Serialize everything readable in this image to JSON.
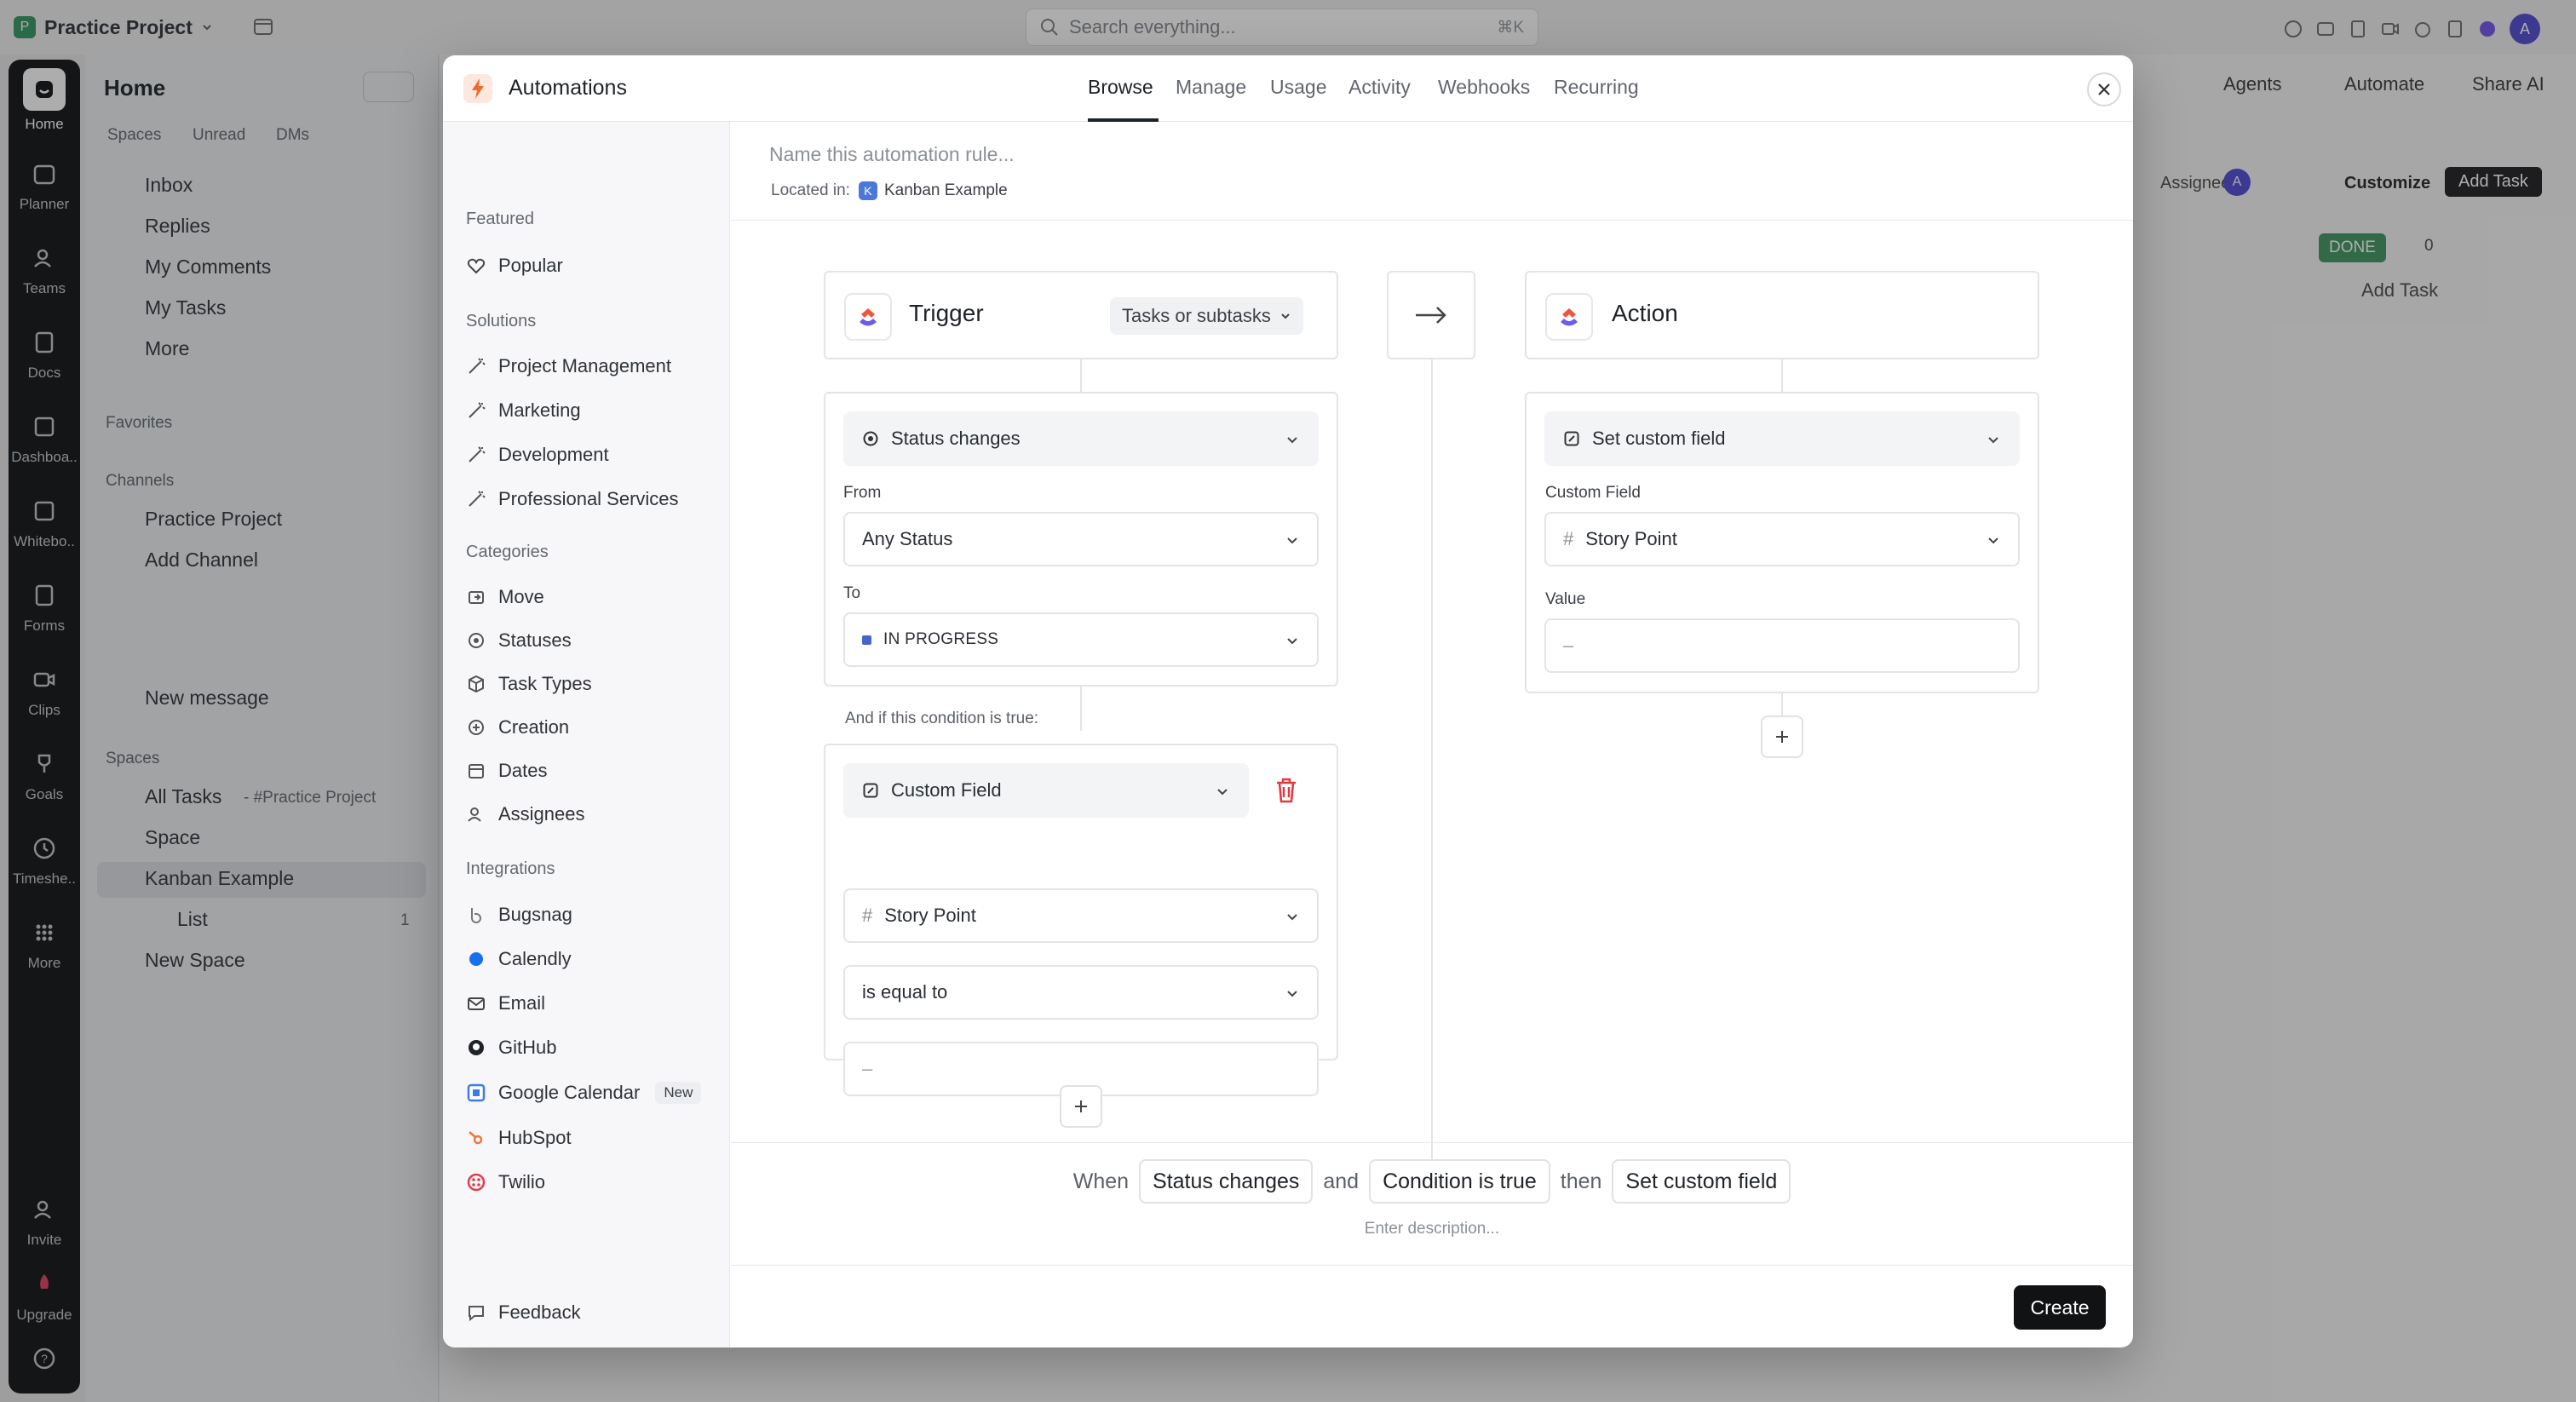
{
  "topbar": {
    "project_initial": "P",
    "project_name": "Practice Project",
    "search_placeholder": "Search everything...",
    "search_shortcut": "⌘K",
    "user_initial": "A"
  },
  "rail": {
    "items": [
      {
        "label": "Home",
        "icon": "home-icon"
      },
      {
        "label": "Planner",
        "icon": "calendar-icon"
      },
      {
        "label": "Teams",
        "icon": "users-icon"
      },
      {
        "label": "Docs",
        "icon": "doc-icon"
      },
      {
        "label": "Dashboa..",
        "icon": "dashboard-icon"
      },
      {
        "label": "Whitebo..",
        "icon": "whiteboard-icon"
      },
      {
        "label": "Forms",
        "icon": "form-icon"
      },
      {
        "label": "Clips",
        "icon": "clip-icon"
      },
      {
        "label": "Goals",
        "icon": "trophy-icon"
      },
      {
        "label": "Timeshe..",
        "icon": "clock-icon"
      },
      {
        "label": "More",
        "icon": "grid-icon"
      }
    ],
    "invite": "Invite",
    "upgrade": "Upgrade"
  },
  "leftnav": {
    "title": "Home",
    "filters": [
      "Spaces",
      "Unread",
      "DMs"
    ],
    "items": [
      "Inbox",
      "Replies",
      "My Comments",
      "My Tasks",
      "More"
    ],
    "favorites": "Favorites",
    "channels": "Channels",
    "channel_items": [
      "Practice Project",
      "Add Channel"
    ],
    "new_message": "New message",
    "spaces": "Spaces",
    "all_tasks": "All Tasks",
    "all_tasks_sub": "- #Practice Project",
    "space": "Space",
    "kanban": "Kanban Example",
    "list": "List",
    "list_count": "1",
    "new_space": "New Space"
  },
  "mainbg": {
    "agents": "Agents",
    "automate": "Automate",
    "share": "Share",
    "ai": "AI",
    "assignee": "Assignee",
    "assignee_initial": "A",
    "customize": "Customize",
    "add_task_btn": "Add Task",
    "done_label": "DONE",
    "done_count": "0",
    "add_task_link": "Add Task"
  },
  "modal": {
    "title": "Automations",
    "tabs": [
      "Browse",
      "Manage",
      "Usage",
      "Activity",
      "Webhooks",
      "Recurring"
    ],
    "active_tab": "Browse",
    "name_placeholder": "Name this automation rule...",
    "located_in_label": "Located in:",
    "located_in_initial": "K",
    "located_in_value": "Kanban Example",
    "sidebar": {
      "featured_header": "Featured",
      "featured": [
        "Popular"
      ],
      "solutions_header": "Solutions",
      "solutions": [
        "Project Management",
        "Marketing",
        "Development",
        "Professional Services"
      ],
      "categories_header": "Categories",
      "categories": [
        "Move",
        "Statuses",
        "Task Types",
        "Creation",
        "Dates",
        "Assignees"
      ],
      "integrations_header": "Integrations",
      "integrations": [
        "Bugsnag",
        "Calendly",
        "Email",
        "GitHub",
        "Google Calendar",
        "HubSpot",
        "Twilio"
      ],
      "new_badge": "New",
      "feedback": "Feedback"
    },
    "trigger": {
      "title": "Trigger",
      "scope": "Tasks or subtasks",
      "event": "Status changes",
      "from_label": "From",
      "from_value": "Any Status",
      "to_label": "To",
      "to_value": "IN PROGRESS",
      "to_color": "#4466cc"
    },
    "condition": {
      "intro": "And if this condition is true:",
      "type": "Custom Field",
      "field": "Story Point",
      "operator": "is equal to",
      "value_placeholder": "–"
    },
    "action": {
      "title": "Action",
      "type": "Set custom field",
      "field_label": "Custom Field",
      "field": "Story Point",
      "value_label": "Value",
      "value_placeholder": "–"
    },
    "summary": {
      "when": "When",
      "trigger": "Status changes",
      "and": "and",
      "condition": "Condition is true",
      "then": "then",
      "action": "Set custom field",
      "description_placeholder": "Enter description..."
    },
    "create": "Create"
  }
}
